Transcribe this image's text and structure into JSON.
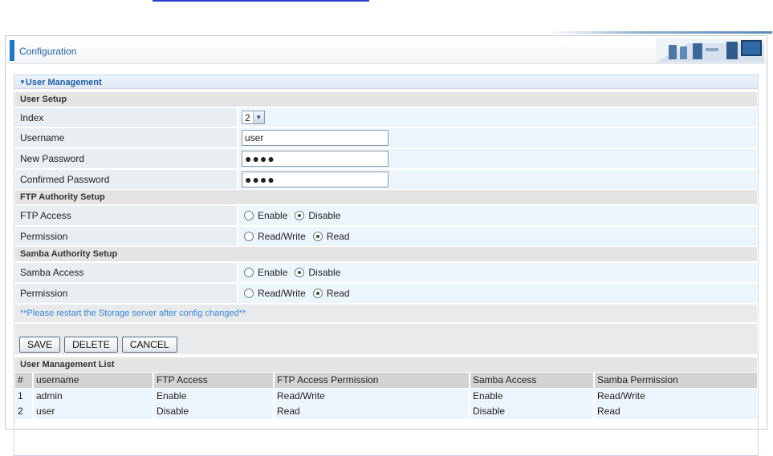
{
  "header": {
    "title": "Configuration"
  },
  "panel": {
    "title": "User Management"
  },
  "user_setup": {
    "section": "User Setup",
    "index": {
      "label": "Index",
      "value": "2"
    },
    "username": {
      "label": "Username",
      "value": "user"
    },
    "new_password": {
      "label": "New Password",
      "value": "●●●●"
    },
    "confirmed_password": {
      "label": "Confirmed Password",
      "value": "●●●●"
    }
  },
  "ftp": {
    "section": "FTP Authority Setup",
    "access": {
      "label": "FTP Access",
      "opt1": "Enable",
      "opt2": "Disable",
      "selected": "Disable"
    },
    "permission": {
      "label": "Permission",
      "opt1": "Read/Write",
      "opt2": "Read",
      "selected": "Read"
    }
  },
  "samba": {
    "section": "Samba Authority Setup",
    "access": {
      "label": "Samba Access",
      "opt1": "Enable",
      "opt2": "Disable",
      "selected": "Disable"
    },
    "permission": {
      "label": "Permission",
      "opt1": "Read/Write",
      "opt2": "Read",
      "selected": "Read"
    }
  },
  "note": "**Please restart the Storage server after config changed**",
  "buttons": {
    "save": "SAVE",
    "delete": "DELETE",
    "cancel": "CANCEL"
  },
  "list": {
    "section": "User Management List",
    "columns": [
      "#",
      "username",
      "FTP Access",
      "FTP Access Permission",
      "Samba Access",
      "Samba Permission"
    ],
    "rows": [
      [
        "1",
        "admin",
        "Enable",
        "Read/Write",
        "Enable",
        "Read/Write"
      ],
      [
        "2",
        "user",
        "Disable",
        "Read",
        "Disable",
        "Read"
      ]
    ]
  },
  "colors": {
    "accent": "#1e78c8",
    "title_text": "#1e5fa8",
    "note_text": "#3a87d6"
  }
}
